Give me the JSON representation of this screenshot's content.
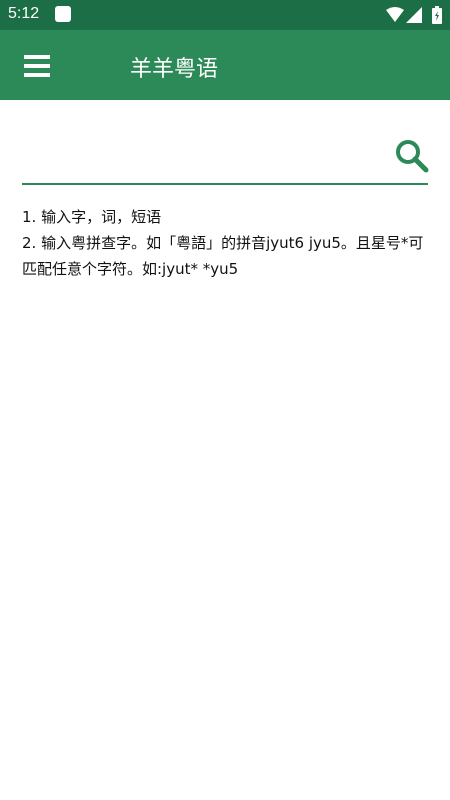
{
  "status_bar": {
    "time": "5:12",
    "icons": [
      "app-notification-icon",
      "wifi-icon",
      "signal-icon",
      "battery-icon"
    ]
  },
  "app_bar": {
    "title": "羊羊粤语",
    "menu_icon": "hamburger-menu-icon",
    "color": "#2b8a57"
  },
  "search": {
    "value": "",
    "placeholder": "",
    "search_icon": "search-icon",
    "accent_color": "#2b8a57"
  },
  "hints": {
    "line1": "1. 输入字，词，短语",
    "line2": "2. 输入粤拼查字。如「粤語」的拼音jyut6  jyu5。且星号*可匹配任意个字符。如:jyut*  *yu5"
  }
}
